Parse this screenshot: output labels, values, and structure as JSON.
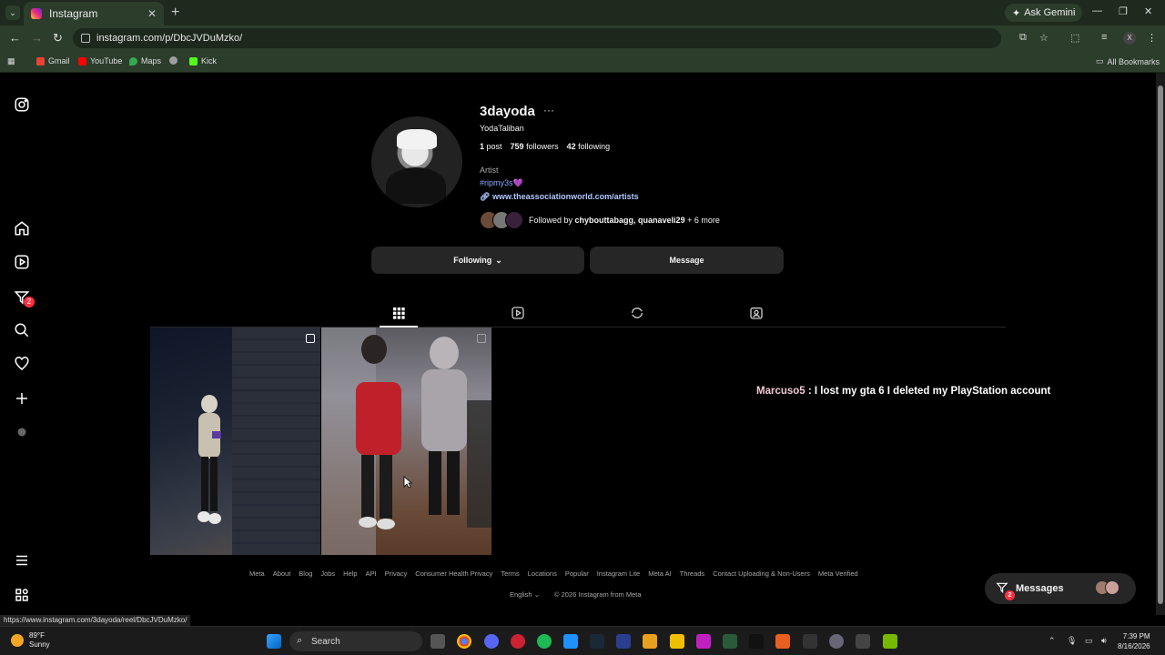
{
  "browser": {
    "tab_title": "Instagram",
    "url": "instagram.com/p/DbcJVDuMzko/",
    "ask_gemini": "Ask Gemini",
    "profile_initial": "X",
    "bookmarks": [
      {
        "label": "Gmail",
        "color": "#ea4335"
      },
      {
        "label": "YouTube",
        "color": "#ff0000"
      },
      {
        "label": "Maps",
        "color": "#34a853"
      },
      {
        "label": "",
        "color": "#9e9e9e"
      },
      {
        "label": "Kick",
        "color": "#53fc18"
      }
    ],
    "all_bookmarks": "All Bookmarks",
    "status_url": "https://www.instagram.com/3dayoda/reel/DbcJVDuMzko/"
  },
  "profile": {
    "username": "3dayoda",
    "more": "···",
    "full_name": "YodaTaliban",
    "posts_count": "1",
    "posts_label": "post",
    "followers_count": "759",
    "followers_label": "followers",
    "following_count": "42",
    "following_label": "following",
    "category": "Artist",
    "bio_hashtag": "#ripmy3s💜",
    "link": "www.theassociationworld.com/artists",
    "followed_by_prefix": "Followed by",
    "followed_by_names": "chybouttabagg, quanaveli29",
    "followed_by_more": "+ 6 more",
    "following_button": "Following",
    "message_button": "Message"
  },
  "tabs": [
    "posts-grid",
    "reels",
    "reposts",
    "tagged"
  ],
  "chat_overlay": {
    "user": "Marcuso5",
    "text": " : I lost my gta 6 I deleted my PlayStation account"
  },
  "footer": {
    "links": [
      "Meta",
      "About",
      "Blog",
      "Jobs",
      "Help",
      "API",
      "Privacy",
      "Consumer Health Privacy",
      "Terms",
      "Locations",
      "Popular",
      "Instagram Lite",
      "Meta AI",
      "Threads",
      "Contact Uploading & Non-Users",
      "Meta Verified"
    ],
    "language": "English",
    "copyright": "© 2026 Instagram from Meta"
  },
  "messages_pill": {
    "label": "Messages",
    "badge": "2"
  },
  "sidenav_badge": "2",
  "taskbar": {
    "temp": "89°F",
    "condition": "Sunny",
    "search": "Search",
    "time": "7:39 PM",
    "date": "8/16/2026"
  }
}
